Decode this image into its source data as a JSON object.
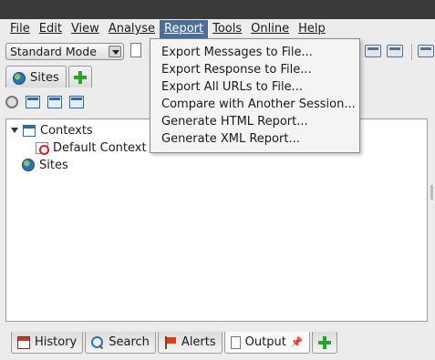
{
  "menubar": {
    "items": [
      {
        "label": "File"
      },
      {
        "label": "Edit"
      },
      {
        "label": "View"
      },
      {
        "label": "Analyse"
      },
      {
        "label": "Report"
      },
      {
        "label": "Tools"
      },
      {
        "label": "Online"
      },
      {
        "label": "Help"
      }
    ]
  },
  "toolbar": {
    "mode_select": "Standard Mode"
  },
  "top_tabs": {
    "sites_label": "Sites"
  },
  "tree": {
    "contexts_label": "Contexts",
    "default_context_label": "Default Context",
    "sites_label": "Sites"
  },
  "report_menu": {
    "items": [
      {
        "label": "Export Messages to File..."
      },
      {
        "label": "Export Response to File..."
      },
      {
        "label": "Export All URLs to File..."
      },
      {
        "label": "Compare with Another Session..."
      },
      {
        "label": "Generate HTML Report..."
      },
      {
        "label": "Generate XML Report..."
      }
    ]
  },
  "bottom_tabs": {
    "history": "History",
    "search": "Search",
    "alerts": "Alerts",
    "output": "Output"
  },
  "colors": {
    "menu_highlight": "#4a6f99",
    "title_bar": "#3a3a3a",
    "add_green": "#2aa52a"
  }
}
